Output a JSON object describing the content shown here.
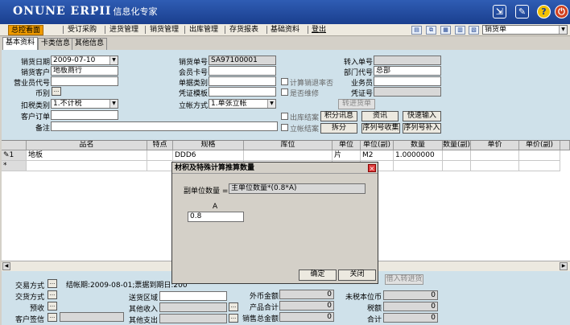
{
  "app": {
    "logo_text": "ONUNE ERPII",
    "logo_cn": "信息化专家"
  },
  "titlebar_icons": [
    "export-icon",
    "edit-icon",
    "help-icon",
    "power-icon"
  ],
  "menu": {
    "items": [
      "总控看面",
      "受订采购",
      "进货管理",
      "销货管理",
      "出库管理",
      "存货报表",
      "基础资料",
      "登出"
    ],
    "module_select": "销货单"
  },
  "tabs": [
    "基本资料",
    "卡类信息",
    "其他信息"
  ],
  "form": {
    "sale_date_label": "销货日期",
    "sale_date": "2009-07-10",
    "customer_label": "销货客户",
    "customer": "地板商行",
    "salesman_id_label": "营业员代号",
    "salesman_id": "",
    "currency_label": "币别",
    "currency_btn": "...",
    "tax_label": "扣税类别",
    "tax": "1.不计税",
    "customer_order_label": "客户订单",
    "customer_order": "",
    "remark_label": "备注",
    "remark": "",
    "sale_no_label": "销货单号",
    "sale_no": "SA97100001",
    "member_card_label": "会员卡号",
    "member_card": "",
    "doc_type_label": "单据类别",
    "doc_type": "",
    "voucher_label": "凭证模板",
    "voucher": "",
    "account_method_label": "立帐方式",
    "account_method": "1.单张立帐",
    "calc_discount_label": "计算销退率否",
    "is_repair_label": "是否维修",
    "transfer_no_label": "转入单号",
    "transfer_no": "",
    "dept_label": "部门代号",
    "dept": "总部",
    "staff_label": "业务员",
    "staff": "",
    "voucher_no_label": "凭证号",
    "voucher_no": "",
    "outbound_done_label": "出库结案",
    "account_done_label": "立帐结案",
    "btn_transfer": "转进货单",
    "btn_points": "积分讯息",
    "btn_info": "资讯",
    "btn_quick": "快速输入",
    "btn_split": "拆分",
    "btn_serial_collect": "序列号收集",
    "btn_serial_fill": "序列号补入"
  },
  "grid": {
    "columns": [
      "品名",
      "特点",
      "规格",
      "库位",
      "单位",
      "单位(副)",
      "数量",
      "数量(副)",
      "单价",
      "单价(副)"
    ],
    "rows": [
      {
        "marker": "✎1",
        "name": "地板",
        "feature": "",
        "spec": "DDD6",
        "location": "",
        "unit": "片",
        "unit2": "M2",
        "qty": "1.0000000",
        "qty2": "",
        "price": "",
        "price2": ""
      }
    ],
    "new_row_marker": "*"
  },
  "footer": {
    "trade_label": "交易方式",
    "deliver_label": "交货方式",
    "prepay_label": "预收",
    "customer_sign_label": "客户签信",
    "settle_text": "结帐期:2009-08-01;票据到期日:200",
    "send_area_label": "送货区域",
    "other_income_label": "其他收入",
    "other_expense_label": "其他支出",
    "foreign_amount_label": "外币金额",
    "foreign_amount": "0",
    "product_total_label": "产品合计",
    "product_total": "0",
    "sales_total_label": "销售总金额",
    "sales_total": "0",
    "untaxed_label": "未税本位币",
    "untaxed": "0",
    "tax_amount_label": "税额",
    "tax_amount": "0",
    "total_label": "合计",
    "total": "0",
    "btn_borrow": "借入转进货"
  },
  "dialog": {
    "title": "材积及特殊计算推算数量",
    "formula_label": "副单位数量 =",
    "formula": "主单位数量*(0.8*A)",
    "param_label": "A",
    "param_value": "0.8",
    "ok": "确定",
    "close": "关闭"
  },
  "colors": {
    "titlebar": "#2f5db4",
    "active_menu": "#ee9a00",
    "form_bg": "#cfe1ea"
  }
}
